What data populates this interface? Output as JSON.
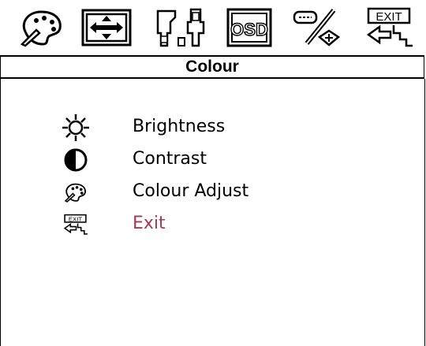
{
  "osd": {
    "title": "Colour",
    "accent_color": "#a33a52",
    "toolbar": [
      {
        "icon": "palette-icon"
      },
      {
        "icon": "position-arrows-icon"
      },
      {
        "icon": "connectors-icon"
      },
      {
        "icon": "osd-icon",
        "text": "OSD"
      },
      {
        "icon": "tools-icon"
      },
      {
        "icon": "exit-icon",
        "text": "EXIT"
      }
    ],
    "menu": [
      {
        "icon": "brightness-icon",
        "label": "Brightness"
      },
      {
        "icon": "contrast-icon",
        "label": "Contrast"
      },
      {
        "icon": "palette-icon",
        "label": "Colour Adjust"
      },
      {
        "icon": "exit-icon",
        "label": "Exit",
        "text": "EXIT",
        "selected": true
      }
    ]
  }
}
